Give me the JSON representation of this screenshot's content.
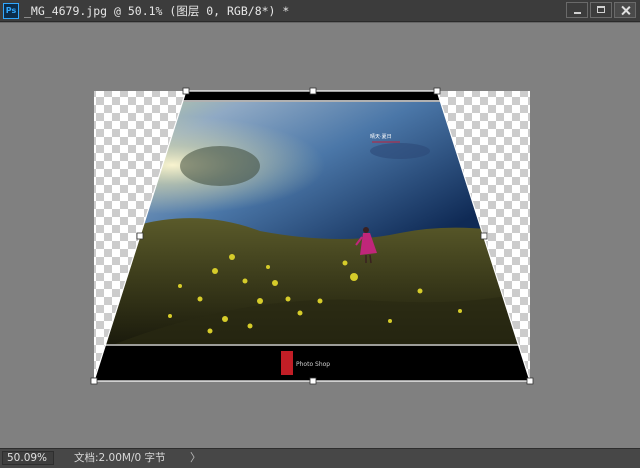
{
  "window": {
    "app_icon_text": "Ps",
    "document_title": "_MG_4679.jpg @ 50.1% (图层 0, RGB/8*) *",
    "controls": [
      "minimize-icon",
      "maximize-icon",
      "close-icon"
    ]
  },
  "canvas": {
    "image_caption_top": "晴天·夏日",
    "footer_logo_text": "Photo Shop",
    "colors": {
      "workspace": "#808080",
      "transform_outline": "#ffffff",
      "banner": "#000000"
    }
  },
  "statusbar": {
    "zoom": "50.09%",
    "doc_info": "文档:2.00M/0 字节",
    "arrow": "〉"
  }
}
